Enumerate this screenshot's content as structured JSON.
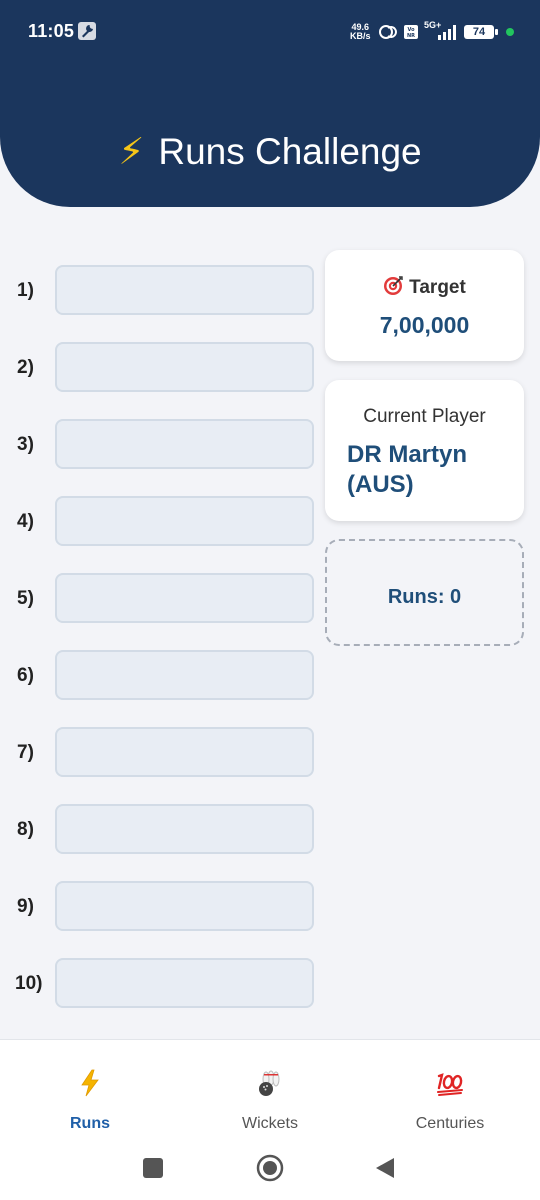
{
  "status": {
    "time": "11:05",
    "speed_top": "49.6",
    "speed_bottom": "KB/s",
    "network": "5G+",
    "battery": "74"
  },
  "header": {
    "title": "Runs Challenge",
    "title_icon": "lightning-bolt-icon"
  },
  "rows": [
    {
      "label": "1)",
      "value": ""
    },
    {
      "label": "2)",
      "value": ""
    },
    {
      "label": "3)",
      "value": ""
    },
    {
      "label": "4)",
      "value": ""
    },
    {
      "label": "5)",
      "value": ""
    },
    {
      "label": "6)",
      "value": ""
    },
    {
      "label": "7)",
      "value": ""
    },
    {
      "label": "8)",
      "value": ""
    },
    {
      "label": "9)",
      "value": ""
    },
    {
      "label": "10)",
      "value": ""
    }
  ],
  "target": {
    "icon": "target-icon",
    "label": "Target",
    "value": "7,00,000"
  },
  "player": {
    "label": "Current Player",
    "name": "DR Martyn (AUS)"
  },
  "runs": {
    "text": "Runs: 0"
  },
  "nav": {
    "items": [
      {
        "label": "Runs",
        "icon": "lightning-icon",
        "active": true
      },
      {
        "label": "Wickets",
        "icon": "bowling-icon",
        "active": false
      },
      {
        "label": "Centuries",
        "icon": "hundred-points-icon",
        "active": false
      }
    ]
  },
  "colors": {
    "header": "#1b365d",
    "accent": "#1f4e79",
    "active_nav": "#1f5fa8",
    "background": "#f3f4f8"
  }
}
